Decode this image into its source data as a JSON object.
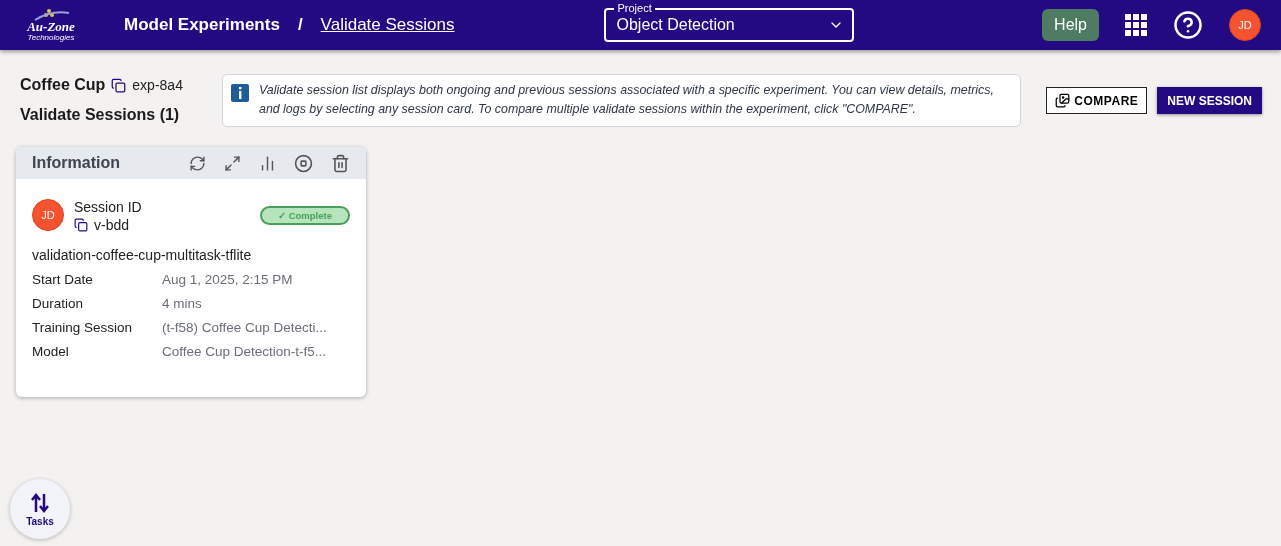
{
  "header": {
    "logo": {
      "name": "Au-Zone",
      "tagline": "Technologies"
    },
    "breadcrumbs": [
      {
        "label": "Model Experiments",
        "link": false
      },
      {
        "label": "/",
        "link": false
      },
      {
        "label": "Validate Sessions",
        "link": true
      }
    ],
    "project_select": {
      "label": "Project",
      "value": "Object Detection"
    },
    "help_button": "Help",
    "user_avatar": "JD"
  },
  "experiment": {
    "name": "Coffee Cup",
    "id": "exp-8a4"
  },
  "section_title": "Validate Sessions (1)",
  "info_note": "Validate session list displays both ongoing and previous sessions associated with a specific experiment. You can view details, metrics, and logs by selecting any session card. To compare multiple validate sessions within the experiment, click \"COMPARE\".",
  "buttons": {
    "compare": "COMPARE",
    "new_session": "NEW SESSION"
  },
  "session_card": {
    "title": "Information",
    "avatar": "JD",
    "id_label": "Session ID",
    "id": "v-bdd",
    "status": {
      "kind": "complete",
      "label": "✓ Complete"
    },
    "name": "validation-coffee-cup-multitask-tflite",
    "fields": [
      {
        "label": "Start Date",
        "value": "Aug 1, 2025, 2:15 PM"
      },
      {
        "label": "Duration",
        "value": "4 mins"
      },
      {
        "label": "Training Session",
        "value": "(t-f58) Coffee Cup Detecti..."
      },
      {
        "label": "Model",
        "value": "Coffee Cup Detection-t-f5..."
      }
    ]
  },
  "tasks_button": "Tasks"
}
